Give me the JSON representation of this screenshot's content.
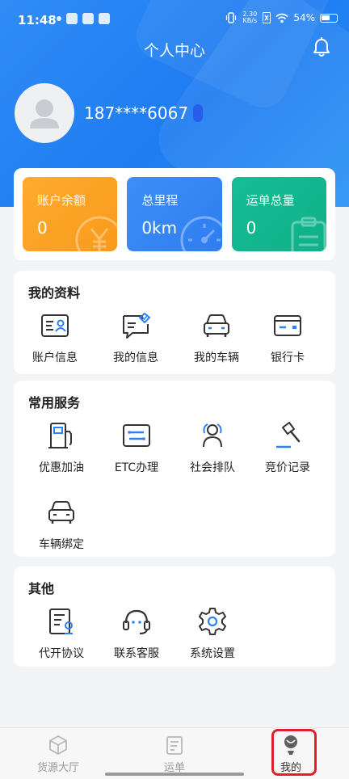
{
  "status_bar": {
    "time": "11:48",
    "net_speed_value": "2.30",
    "net_speed_unit": "KB/s",
    "battery": "54%"
  },
  "header": {
    "title": "个人中心"
  },
  "user": {
    "phone": "187****6067"
  },
  "stats": [
    {
      "label": "账户余额",
      "value": "0",
      "color": "#f9a21f"
    },
    {
      "label": "总里程",
      "value": "0km",
      "color": "#3386f5"
    },
    {
      "label": "运单总量",
      "value": "0",
      "color": "#13b78f"
    }
  ],
  "my_profile": {
    "title": "我的资料",
    "items": [
      {
        "label": "账户信息",
        "icon": "id-card-icon"
      },
      {
        "label": "我的信息",
        "icon": "message-info-icon"
      },
      {
        "label": "我的车辆",
        "icon": "car-icon"
      },
      {
        "label": "银行卡",
        "icon": "bank-card-icon"
      }
    ]
  },
  "services": {
    "title": "常用服务",
    "items": [
      {
        "label": "优惠加油",
        "icon": "fuel-pump-icon"
      },
      {
        "label": "ETC办理",
        "icon": "etc-card-icon"
      },
      {
        "label": "社会排队",
        "icon": "queue-users-icon"
      },
      {
        "label": "竞价记录",
        "icon": "auction-gavel-icon"
      },
      {
        "label": "车辆绑定",
        "icon": "car-bind-icon"
      }
    ]
  },
  "other": {
    "title": "其他",
    "items": [
      {
        "label": "代开协议",
        "icon": "agreement-icon"
      },
      {
        "label": "联系客服",
        "icon": "headset-icon"
      },
      {
        "label": "系统设置",
        "icon": "settings-gear-icon"
      }
    ]
  },
  "tabbar": {
    "items": [
      {
        "label": "货源大厅",
        "icon": "cube-icon"
      },
      {
        "label": "运单",
        "icon": "document-icon"
      },
      {
        "label": "我的",
        "icon": "profile-icon",
        "active": true
      }
    ],
    "highlight_color": "#e0202a"
  },
  "colors": {
    "primary": "#2a87f5",
    "accent_blue": "#3d8ef8"
  }
}
